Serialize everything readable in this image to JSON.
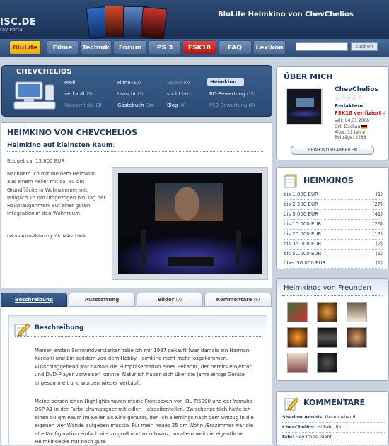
{
  "header": {
    "logo_text": "ISC.DE",
    "logo_sub": "ray Portal",
    "site_title": "BluLife Heimkino von ChevChelios"
  },
  "nav": {
    "items": [
      "BluLife",
      "Filme",
      "Technik",
      "Forum",
      "PS 3",
      "FSK18",
      "FAQ",
      "Lexikon"
    ],
    "search_placeholder": "",
    "search_button": "suchen"
  },
  "profile": {
    "name": "CHEVCHELIOS",
    "links": [
      {
        "label": "Profil",
        "count": ""
      },
      {
        "label": "verkauft",
        "count": "(7)"
      },
      {
        "label": "Wunschliste",
        "count": "(0)"
      },
      {
        "label": "Filme",
        "count": "(67)"
      },
      {
        "label": "tauscht",
        "count": "(7)"
      },
      {
        "label": "Gästebuch",
        "count": "(30)"
      },
      {
        "label": "Spiele",
        "count": "(0)"
      },
      {
        "label": "sucht",
        "count": "(91)"
      },
      {
        "label": "Blog",
        "count": "(0)"
      },
      {
        "label": "Heimkino",
        "count": ""
      },
      {
        "label": "BD-Bewertung",
        "count": "(35)"
      },
      {
        "label": "PS3-Bewertung",
        "count": "(0)"
      }
    ]
  },
  "main": {
    "title": "HEIMKINO VON CHEVCHELIOS",
    "subtitle": "Heimkino auf kleinsten Raum",
    "subtitle_colon": ":",
    "budget": "Budget ca. 13.800 EUR",
    "intro": "Nachdem ich mit meinem Heimkino aus einem Keller mit ca. 50 qm Grundfläche in Wohnzimmer mit lediglich 15 qm umgezogen bin, lag der Hauptaugenmerk auf einer guten Integration in den Wohnraum.",
    "updated": "Letzte Aktualisierung: 08. März 2009"
  },
  "tabs": [
    {
      "label": "Beschreibung",
      "count": ""
    },
    {
      "label": "Ausstattung",
      "count": ""
    },
    {
      "label": "Bilder",
      "count": "(7)"
    },
    {
      "label": "Kommentare",
      "count": "(8)"
    }
  ],
  "description": {
    "title": "Beschreibung",
    "p1": "Meinen ersten Surroundverstärker habe ich mir 1997 gekauft (war damals ein Harman-Kardon) und bin seitdem von dem Hobby Heimkino nicht mehr losgekommen. Ausschlaggebend war damals die Filmpräsentation eines Bekannt, der bereits Projektor und DVD-Player vorweisen konnte. Natürlich haben sich über die Jahre einige Geräte angesammelt und wurden wieder verkauft.",
    "p2": "Meine persönlichen Highlights waren meine Frontboxen von JBL TI5000 und der Yamaha DSP-A1 in der Farbe champagner mit edlen Holzseitenteilen. Zwischenzeitlich hatte ich einen 50 qm Raum im Keller als Kino genutzt, den ich allerdings nach dem Umzug in die eigenen vier Wände aufgeben musste. Für mein neues 25 qm Wohn-/Esszimmer war die alte Konfiguration einfach viel zu groß und zu schwarz, vorallem weil die eigentliche Heimkinoecke nur noch gute"
  },
  "about": {
    "title": "ÜBER MICH",
    "name": "ChevChelios",
    "stars": "☆☆☆☆☆",
    "role": "Redakteur",
    "fsk": "FSK18 verifiziert",
    "fsk_check": "✓",
    "since": "seit: 04.01.2008",
    "ort": "Ort: Dachau",
    "alter": "Alter: 31 Jahre",
    "beitraege": "Beiträge: 2288",
    "edit_button": "HEIMKINO BEARBEITEN"
  },
  "heimkinos": {
    "title": "HEIMKINOS",
    "rows": [
      {
        "label": "bis 1.000 EUR",
        "count": "(1)"
      },
      {
        "label": "bis 2.500 EUR",
        "count": "(27)"
      },
      {
        "label": "bis 5.000 EUR",
        "count": "(41)"
      },
      {
        "label": "bis 10.000 EUR",
        "count": "(26)"
      },
      {
        "label": "bis 20.000 EUR",
        "count": "(12)"
      },
      {
        "label": "bis 35.000 EUR",
        "count": "(2)"
      },
      {
        "label": "bis 50.000 EUR",
        "count": "(1)"
      },
      {
        "label": "über 50.000 EUR",
        "count": "(1)"
      }
    ]
  },
  "freunde": {
    "title": "Heimkinos von Freunden"
  },
  "kommentare": {
    "title": "KOMMENTARE",
    "rows": [
      {
        "user": "Shadow Anubis:",
        "text": "Guten Abend ..."
      },
      {
        "user": "ChevChelios:",
        "text": "Hi Fabi, für ..."
      },
      {
        "user": "fabi:",
        "text": "Hey Chris, sieht ..."
      }
    ]
  },
  "colors": {
    "accent_dark": "#1d3b66",
    "nav_yellow": "#f0a800",
    "nav_red": "#b3150f",
    "fsk_red": "#cc1111"
  }
}
